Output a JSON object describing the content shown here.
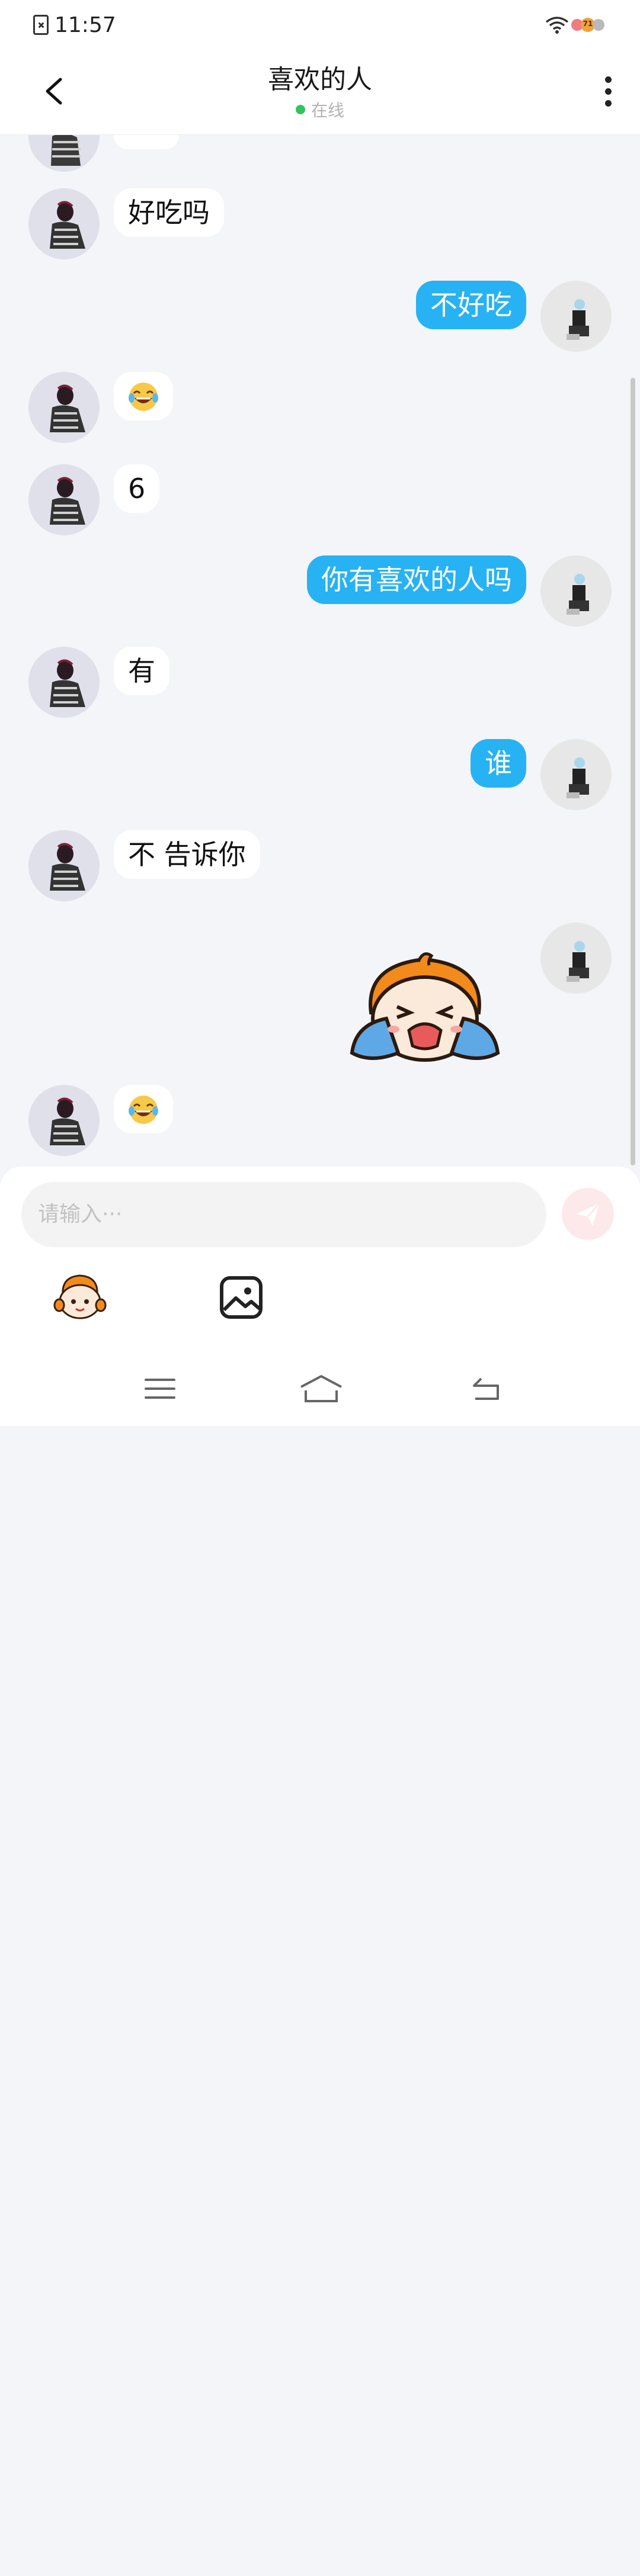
{
  "status_bar": {
    "time": "11:57",
    "battery_badge": "71"
  },
  "header": {
    "title": "喜欢的人",
    "status": "在线"
  },
  "messages": [
    {
      "side": "left",
      "text": "好吃吗"
    },
    {
      "side": "right",
      "text": "不好吃"
    },
    {
      "side": "left",
      "emoji": "laughing-tears"
    },
    {
      "side": "left",
      "text": "6"
    },
    {
      "side": "right",
      "text": "你有喜欢的人吗"
    },
    {
      "side": "left",
      "text": "有"
    },
    {
      "side": "right",
      "text": "谁"
    },
    {
      "side": "left",
      "text": "不 告诉你"
    },
    {
      "side": "right",
      "sticker": "crying-mascot"
    },
    {
      "side": "left",
      "emoji": "laughing-tears"
    }
  ],
  "composer": {
    "placeholder": "请输入···"
  },
  "colors": {
    "my_bubble": "#27b2f3",
    "their_bubble": "#ffffff",
    "online": "#31c45c",
    "background": "#f4f5f8"
  }
}
